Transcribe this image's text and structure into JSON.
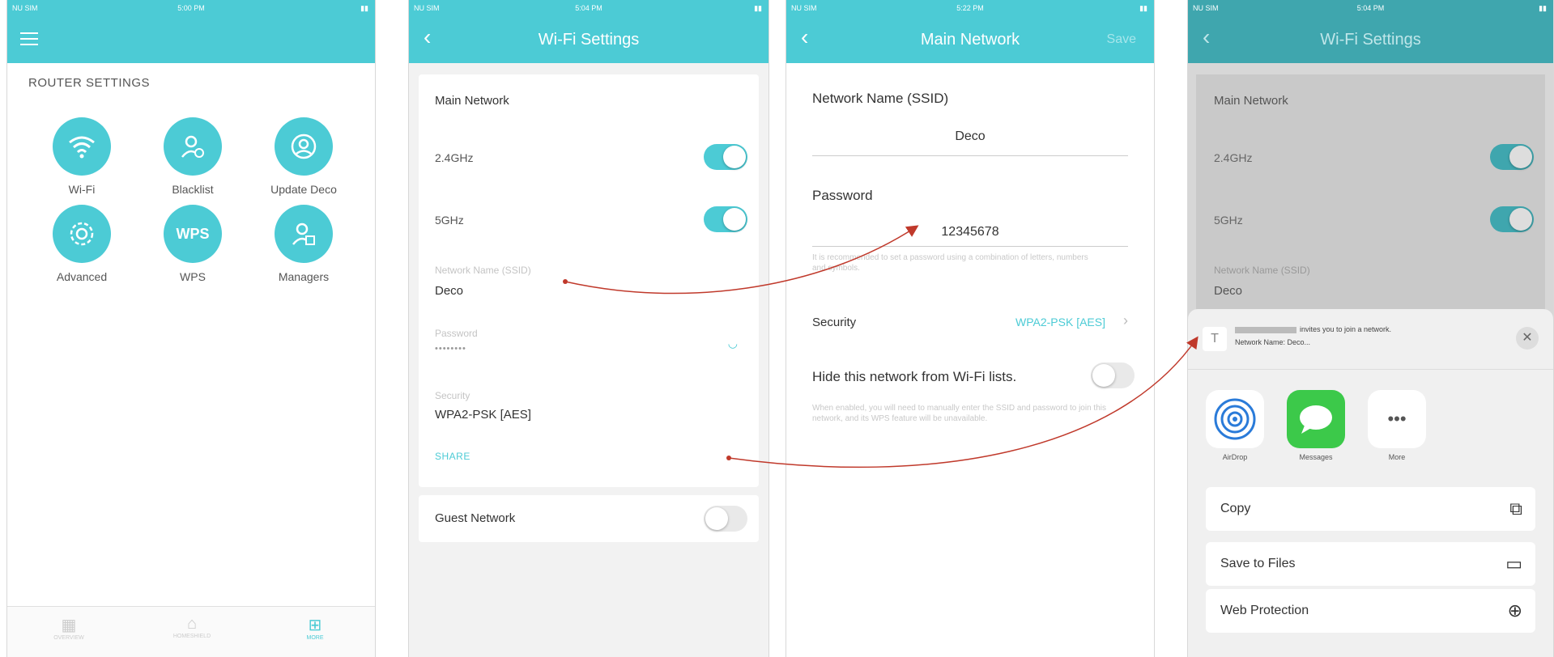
{
  "phone1": {
    "status": {
      "carrier": "NU SIM",
      "time": "5:00 PM"
    },
    "section_title": "ROUTER SETTINGS",
    "icons": [
      {
        "label": "Wi-Fi",
        "icon": "wifi-icon"
      },
      {
        "label": "Blacklist",
        "icon": "blacklist-icon"
      },
      {
        "label": "Update Deco",
        "icon": "update-icon"
      },
      {
        "label": "Advanced",
        "icon": "gear-icon"
      },
      {
        "label": "WPS",
        "icon": "wps-icon"
      },
      {
        "label": "Managers",
        "icon": "managers-icon"
      }
    ],
    "wps_text": "WPS",
    "tabs": [
      {
        "label": "OVERVIEW",
        "icon": "overview-icon"
      },
      {
        "label": "HOMESHIELD",
        "icon": "homeshield-icon"
      },
      {
        "label": "MORE",
        "icon": "more-icon"
      }
    ]
  },
  "phone2": {
    "status": {
      "carrier": "NU SIM",
      "time": "5:04 PM"
    },
    "title": "Wi-Fi Settings",
    "main_network": "Main Network",
    "band1": "2.4GHz",
    "band2": "5GHz",
    "ssid_label": "Network Name (SSID)",
    "ssid_value": "Deco",
    "password_label": "Password",
    "password_value": "••••••••",
    "security_label": "Security",
    "security_value": "WPA2-PSK [AES]",
    "share": "SHARE",
    "guest": "Guest Network"
  },
  "phone3": {
    "status": {
      "carrier": "NU SIM",
      "time": "5:22 PM"
    },
    "title": "Main Network",
    "save": "Save",
    "ssid_label": "Network Name (SSID)",
    "ssid_value": "Deco",
    "password_label": "Password",
    "password_value": "12345678",
    "password_hint": "It is recommended to set a password using a combination of letters, numbers and symbols.",
    "security_label": "Security",
    "security_value": "WPA2-PSK [AES]",
    "hide_label": "Hide this network from Wi-Fi lists.",
    "hide_hint": "When enabled, you will need to manually enter the SSID and password to join this network, and its WPS feature will be unavailable."
  },
  "phone4": {
    "status": {
      "carrier": "NU SIM",
      "time": "5:04 PM"
    },
    "title": "Wi-Fi Settings",
    "main_network": "Main Network",
    "band1": "2.4GHz",
    "band2": "5GHz",
    "ssid_label": "Network Name (SSID)",
    "ssid_value": "Deco",
    "invite_line1": "invites you to join a network.",
    "invite_line2": "Network Name: Deco...",
    "apps": [
      {
        "label": "AirDrop",
        "icon": "airdrop-icon"
      },
      {
        "label": "Messages",
        "icon": "messages-icon"
      },
      {
        "label": "More",
        "icon": "more-dots-icon"
      }
    ],
    "actions": [
      {
        "label": "Copy",
        "icon": "copy-icon"
      },
      {
        "label": "Save to Files",
        "icon": "folder-icon"
      },
      {
        "label": "Web Protection",
        "icon": "globe-icon"
      }
    ]
  },
  "colors": {
    "accent": "#4ccbd5",
    "arrow": "#c0392b"
  }
}
